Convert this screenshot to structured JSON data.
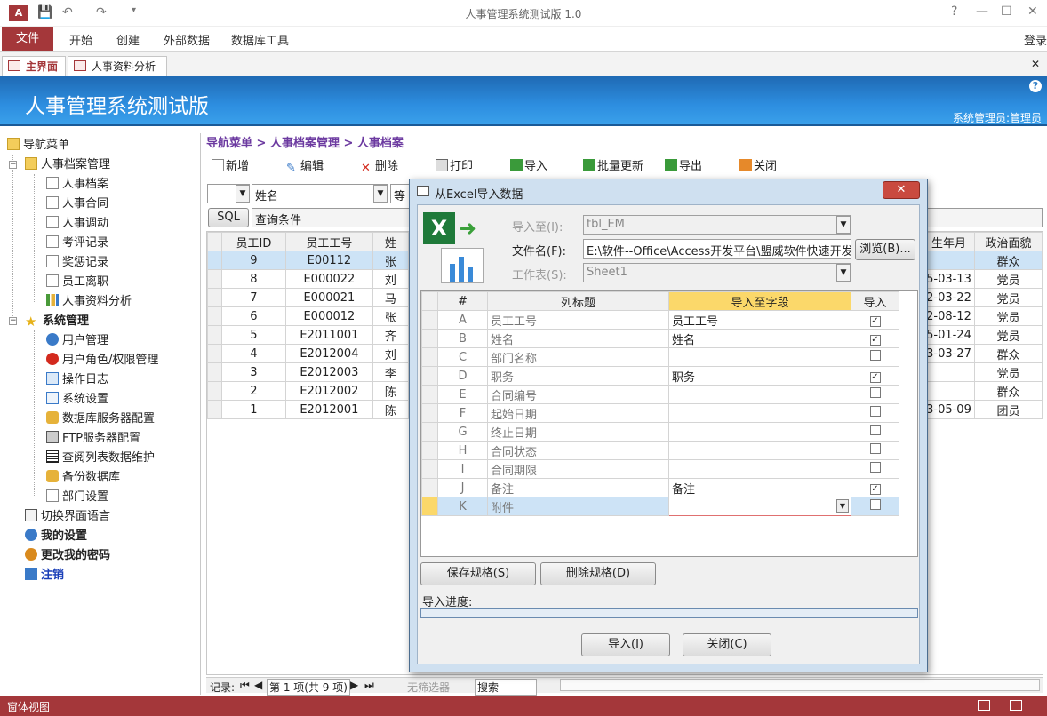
{
  "app": {
    "title": "人事管理系统测试版 1.0",
    "login_label": "登录",
    "help_icon": "?",
    "minimize_icon": "—",
    "maximize_icon": "☐",
    "close_icon": "✕",
    "doc_close_icon": "✕"
  },
  "ribbon": {
    "tabs": [
      "文件",
      "开始",
      "创建",
      "外部数据",
      "数据库工具"
    ]
  },
  "doc_tabs": [
    "主界面",
    "人事资料分析"
  ],
  "banner": {
    "title": "人事管理系统测试版",
    "user": "系统管理员:管理员"
  },
  "nav": {
    "root": "导航菜单",
    "group1": "人事档案管理",
    "group1_items": [
      "人事档案",
      "人事合同",
      "人事调动",
      "考评记录",
      "奖惩记录",
      "员工离职",
      "人事资料分析"
    ],
    "group2": "系统管理",
    "group2_items": [
      "用户管理",
      "用户角色/权限管理",
      "操作日志",
      "系统设置",
      "数据库服务器配置",
      "FTP服务器配置",
      "查阅列表数据维护",
      "备份数据库",
      "部门设置"
    ],
    "extra_items": [
      "切换界面语言",
      "我的设置",
      "更改我的密码",
      "注销"
    ]
  },
  "main": {
    "breadcrumb": "导航菜单 > 人事档案管理 > 人事档案",
    "toolbar": [
      "新增",
      "编辑",
      "删除",
      "打印",
      "导入",
      "批量更新",
      "导出",
      "关闭"
    ],
    "filter_field": "姓名",
    "filter_op": "等于",
    "sql_label": "SQL",
    "query_label": "查询条件",
    "columns": [
      "员工ID",
      "员工工号",
      "姓",
      "生年月",
      "政治面貌"
    ],
    "rows": [
      {
        "id": "9",
        "code": "E00112",
        "name": "张",
        "date": "",
        "party": "群众"
      },
      {
        "id": "8",
        "code": "E000022",
        "name": "刘",
        "date": "5-03-13",
        "party": "党员"
      },
      {
        "id": "7",
        "code": "E000021",
        "name": "马",
        "date": "2-03-22",
        "party": "党员"
      },
      {
        "id": "6",
        "code": "E000012",
        "name": "张",
        "date": "2-08-12",
        "party": "党员"
      },
      {
        "id": "5",
        "code": "E2011001",
        "name": "齐",
        "date": "5-01-24",
        "party": "党员"
      },
      {
        "id": "4",
        "code": "E2012004",
        "name": "刘",
        "date": "3-03-27",
        "party": "群众"
      },
      {
        "id": "3",
        "code": "E2012003",
        "name": "李",
        "date": "",
        "party": "党员"
      },
      {
        "id": "2",
        "code": "E2012002",
        "name": "陈",
        "date": "",
        "party": "群众"
      },
      {
        "id": "1",
        "code": "E2012001",
        "name": "陈",
        "date": "3-05-09",
        "party": "团员"
      }
    ],
    "record_nav": {
      "label": "记录:",
      "position": "第 1 项(共 9 项)",
      "filter": "无筛选器",
      "search": "搜索"
    }
  },
  "dialog": {
    "title": "从Excel导入数据",
    "import_to_label": "导入至(I):",
    "import_to_value": "tbl_EM",
    "file_label": "文件名(F):",
    "file_value": "E:\\软件--Office\\Access开发平台\\盟威软件快速开发",
    "browse": "浏览(B)...",
    "sheet_label": "工作表(S):",
    "sheet_value": "Sheet1",
    "col_headers": [
      "#",
      "列标题",
      "导入至字段",
      "导入"
    ],
    "rows": [
      {
        "key": "A",
        "title": "员工工号",
        "field": "员工工号",
        "checked": true
      },
      {
        "key": "B",
        "title": "姓名",
        "field": "姓名",
        "checked": true
      },
      {
        "key": "C",
        "title": "部门名称",
        "field": "",
        "checked": false
      },
      {
        "key": "D",
        "title": "职务",
        "field": "职务",
        "checked": true
      },
      {
        "key": "E",
        "title": "合同编号",
        "field": "",
        "checked": false
      },
      {
        "key": "F",
        "title": "起始日期",
        "field": "",
        "checked": false
      },
      {
        "key": "G",
        "title": "终止日期",
        "field": "",
        "checked": false
      },
      {
        "key": "H",
        "title": "合同状态",
        "field": "",
        "checked": false
      },
      {
        "key": "I",
        "title": "合同期限",
        "field": "",
        "checked": false
      },
      {
        "key": "J",
        "title": "备注",
        "field": "备注",
        "checked": true
      },
      {
        "key": "K",
        "title": "附件",
        "field": "",
        "checked": false
      }
    ],
    "save_spec": "保存规格(S)",
    "delete_spec": "删除规格(D)",
    "progress_label": "导入进度:",
    "progress": 0,
    "import_btn": "导入(I)",
    "close_btn": "关闭(C)"
  },
  "status": {
    "text": "窗体视图"
  }
}
